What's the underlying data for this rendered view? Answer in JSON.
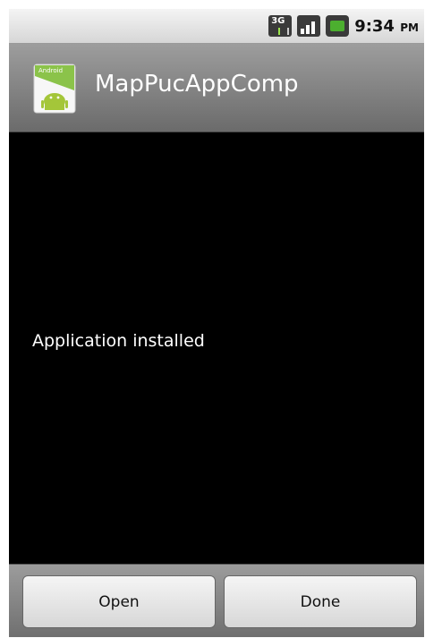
{
  "status_bar": {
    "network_type": "3G",
    "time": "9:34",
    "time_suffix": "PM",
    "icons": [
      "3g-data-icon",
      "signal-strength-icon",
      "battery-icon"
    ]
  },
  "title_bar": {
    "app_icon_text": "Android",
    "app_name": "MapPucAppComp"
  },
  "body": {
    "message": "Application installed"
  },
  "buttons": {
    "open_label": "Open",
    "done_label": "Done"
  },
  "colors": {
    "background": "#000000",
    "title_bar": "#8a8a8a",
    "button_face": "#e6e6e6",
    "android_green": "#8bc34a"
  }
}
